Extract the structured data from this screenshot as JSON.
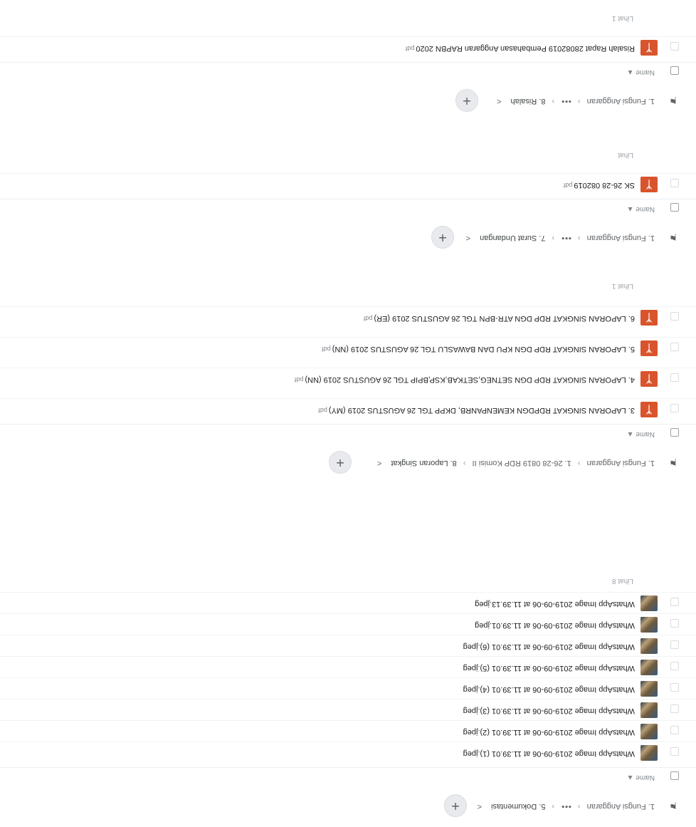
{
  "colors": {
    "pdf": "#d9542c",
    "accent": "#5f6368"
  },
  "header_label": "Name",
  "sections": [
    {
      "id": "dokumentasi",
      "root": "1. Fungsi Anggaran",
      "folder": "5. Dokumentasi",
      "more_text": "Lihat 8",
      "files": [
        {
          "name": "WhatsApp Image 2019-09-06 at 11.39.01 (1).jpeg",
          "type": "image"
        },
        {
          "name": "WhatsApp Image 2019-09-06 at 11.39.01 (2).jpeg",
          "type": "image"
        },
        {
          "name": "WhatsApp Image 2019-09-06 at 11.39.01 (3).jpeg",
          "type": "image"
        },
        {
          "name": "WhatsApp Image 2019-09-06 at 11.39.01 (4).jpeg",
          "type": "image"
        },
        {
          "name": "WhatsApp Image 2019-09-06 at 11.39.01 (5).jpeg",
          "type": "image"
        },
        {
          "name": "WhatsApp Image 2019-09-06 at 11.39.01 (6).jpeg",
          "type": "image"
        },
        {
          "name": "WhatsApp Image 2019-09-06 at 11.39.01.jpeg",
          "type": "image"
        },
        {
          "name": "WhatsApp Image 2019-09-06 at 11.39.13.jpeg",
          "type": "image"
        }
      ]
    },
    {
      "id": "laporan",
      "root": "1. Fungsi Anggaran",
      "mid": "1. 26-28 0819 RDP Komisi II",
      "folder": "8. Laporan Singkat",
      "more_text": "Lihat 1",
      "files": [
        {
          "name": "3. LAPORAN SINGKAT RDPDGN KEMENPANRB, DKPP TGL 26 AGUSTUS 2019 (MY)",
          "ext": "pdf",
          "type": "pdf"
        },
        {
          "name": "4. LAPORAN SINGKAT RDP DGN SETNEG,SETKAB,KSP,BPIP TGL 26 AGUSTUS 2019 (NN)",
          "ext": "pdf",
          "type": "pdf"
        },
        {
          "name": "5. LAPORAN SINGKAT RDP DGN KPU DAN BAWASLU TGL 26 AGUSTUS 2019 (NN)",
          "ext": "pdf",
          "type": "pdf"
        },
        {
          "name": "6. LAPORAN SINGKAT RDP DGN ATR-BPN TGL 26 AGUSTUS 2019 (ER)",
          "ext": "pdf",
          "type": "pdf"
        }
      ]
    },
    {
      "id": "surat",
      "root": "1. Fungsi Anggaran",
      "folder": "7. Surat Undangan",
      "more_text": "Lihat",
      "files": [
        {
          "name": "SK 26-28 082019",
          "ext": "pdf",
          "type": "pdf"
        }
      ]
    },
    {
      "id": "risalah",
      "root": "1. Fungsi Anggaran",
      "folder": "8. Risalah",
      "more_text": "Lihat 1",
      "files": [
        {
          "name": "Risalah Rapat 28082019 Pembahasan Anggaran RAPBN 2020",
          "ext": "pdf",
          "type": "pdf"
        }
      ]
    }
  ]
}
